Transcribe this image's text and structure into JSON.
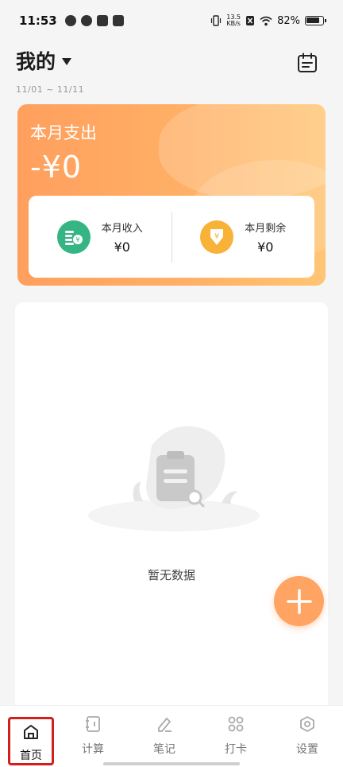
{
  "status_bar": {
    "time": "11:53",
    "net_speed_value": "13.5",
    "net_speed_unit": "KB/s",
    "battery": "82%"
  },
  "header": {
    "book_name": "我的",
    "date_range": "11/01 ~ 11/11"
  },
  "summary": {
    "expense_label": "本月支出",
    "expense_value": "-¥0",
    "income_label": "本月收入",
    "income_value": "¥0",
    "balance_label": "本月剩余",
    "balance_value": "¥0"
  },
  "records": {
    "empty_text": "暂无数据"
  },
  "nav": {
    "items": [
      {
        "label": "首页",
        "icon": "home-icon"
      },
      {
        "label": "计算",
        "icon": "calculator-icon"
      },
      {
        "label": "笔记",
        "icon": "pen-icon"
      },
      {
        "label": "打卡",
        "icon": "grid-icon"
      },
      {
        "label": "设置",
        "icon": "settings-icon"
      }
    ]
  },
  "colors": {
    "accent": "#ffa462",
    "income_icon": "#35b583",
    "balance_icon": "#f9b238",
    "highlight": "#d0201c"
  }
}
